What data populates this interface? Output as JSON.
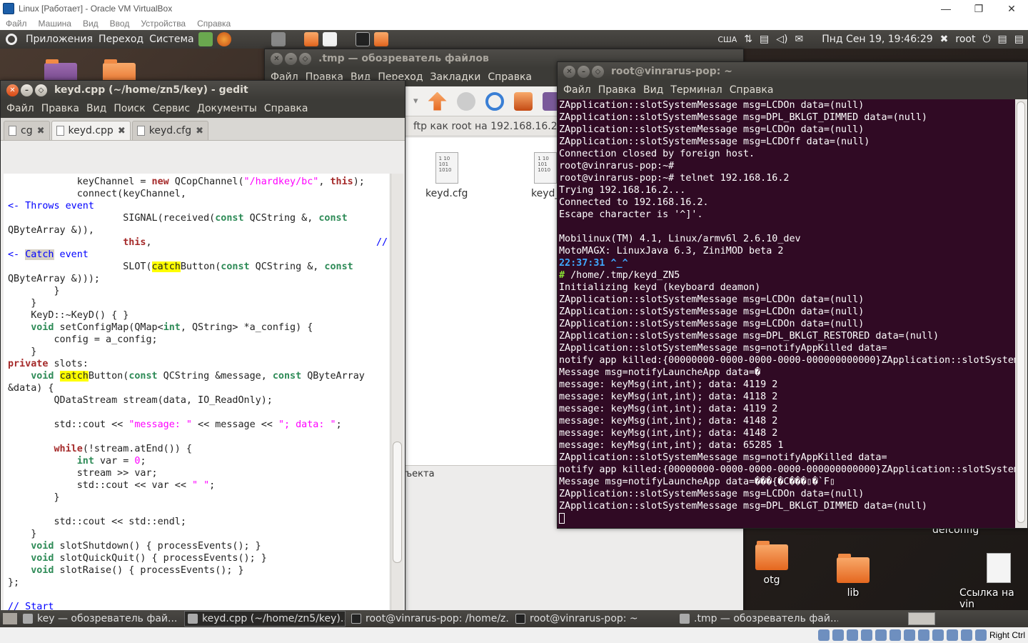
{
  "vbox": {
    "title": "Linux [Работает] - Oracle VM VirtualBox",
    "menu": [
      "Файл",
      "Машина",
      "Вид",
      "Ввод",
      "Устройства",
      "Справка"
    ],
    "hostkey": "Right Ctrl"
  },
  "panel": {
    "menus": [
      "Приложения",
      "Переход",
      "Система"
    ],
    "keyboard": "США",
    "datetime": "Пнд Сен 19, 19:46:29",
    "user": "root"
  },
  "desktop": {
    "icons": [
      "otg",
      "lib",
      "Ссылка на vin",
      "defconfig"
    ]
  },
  "filemanager": {
    "title": ".tmp — обозреватель файлов",
    "menu": [
      "Файл",
      "Правка",
      "Вид",
      "Переход",
      "Закладки",
      "Справка"
    ],
    "location": "ftp как root на 192.168.16.2",
    "files": [
      "keyd.cfg",
      "keyd_"
    ],
    "status": "ъекта"
  },
  "gedit": {
    "title": "keyd.cpp (~/home/zn5/key) - gedit",
    "menu": [
      "Файл",
      "Правка",
      "Вид",
      "Поиск",
      "Сервис",
      "Документы",
      "Справка"
    ],
    "tabs": [
      "cg",
      "keyd.cpp",
      "keyd.cfg"
    ]
  },
  "terminal": {
    "title": "root@vinrarus-pop: ~",
    "menu": [
      "Файл",
      "Правка",
      "Вид",
      "Терминал",
      "Справка"
    ],
    "lines": [
      "ZApplication::slotSystemMessage msg=LCDOn data=(null)",
      "ZApplication::slotSystemMessage msg=DPL_BKLGT_DIMMED data=(null)",
      "ZApplication::slotSystemMessage msg=LCDOn data=(null)",
      "ZApplication::slotSystemMessage msg=LCDOff data=(null)",
      "Connection closed by foreign host.",
      "root@vinrarus-pop:~#",
      "root@vinrarus-pop:~# telnet 192.168.16.2",
      "Trying 192.168.16.2...",
      "Connected to 192.168.16.2.",
      "Escape character is '^]'.",
      "",
      "Mobilinux(TM) 4.1, Linux/armv6l 2.6.10_dev",
      "MotoMAGX: LinuxJava 6.3, ZiniMOD beta 2",
      "",
      "",
      "Initializing keyd (keyboard deamon)",
      "ZApplication::slotSystemMessage msg=LCDOn data=(null)",
      "ZApplication::slotSystemMessage msg=LCDOn data=(null)",
      "ZApplication::slotSystemMessage msg=LCDOn data=(null)",
      "ZApplication::slotSystemMessage msg=DPL_BKLGT_RESTORED data=(null)",
      "ZApplication::slotSystemMessage msg=notifyAppKilled data=",
      "notify app killed:{00000000-0000-0000-0000-000000000000}ZApplication::slotSystem",
      "Message msg=notifyLauncheApp data=�",
      "message: keyMsg(int,int); data: 4119 2",
      "message: keyMsg(int,int); data: 4118 2",
      "message: keyMsg(int,int); data: 4119 2",
      "message: keyMsg(int,int); data: 4148 2",
      "message: keyMsg(int,int); data: 4148 2",
      "message: keyMsg(int,int); data: 65285 1",
      "ZApplication::slotSystemMessage msg=notifyAppKilled data=",
      "notify app killed:{00000000-0000-0000-0000-000000000000}ZApplication::slotSystem",
      "Message msg=notifyLauncheApp data=���{�C���▯�`F▯",
      "ZApplication::slotSystemMessage msg=LCDOn data=(null)",
      "ZApplication::slotSystemMessage msg=DPL_BKLGT_DIMMED data=(null)"
    ],
    "time_prompt": "22:37:31 ^_^",
    "path_prompt": " /home/.tmp/keyd_ZN5"
  },
  "taskbar": [
    "key — обозреватель фай...",
    "keyd.cpp (~/home/zn5/key)...",
    "root@vinrarus-pop: /home/z...",
    "root@vinrarus-pop: ~",
    ".tmp — обозреватель фай..."
  ]
}
